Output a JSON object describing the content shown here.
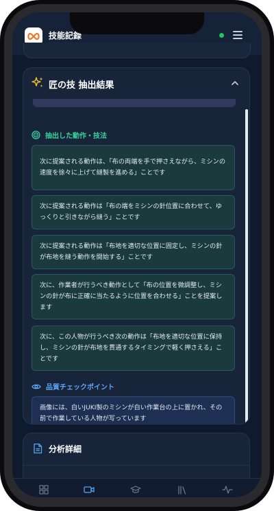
{
  "app": {
    "title": "技能記録",
    "logo_text": "",
    "status_color": "#22c55e"
  },
  "extraction": {
    "title": "匠の技 抽出結果",
    "icon": "sparkle-icon",
    "motions_label": "抽出した動作・技法",
    "motions": [
      "次に提案される動作は、「布の両端を手で押さえながら、ミシンの速度を徐々に上げて縫製を進める」ことです",
      "次に提案される動作は「布の端をミシンの針位置に合わせて、ゆっくりと引きながら縫う」ことです",
      "次に提案される動作は「布地を適切な位置に固定し、ミシンの針が布地を縫う動作を開始する」ことです",
      "次に、作業者が行うべき動作として「布の位置を微調整し、ミシンの針が布に正確に当たるように位置を合わせる」ことを提案します",
      "次に、この人物が行うべき次の動作は「布地を適切な位置に保持し、ミシンの針が布地を貫通するタイミングで軽く押さえる」ことです"
    ],
    "quality_label": "品質チェックポイント",
    "quality_items": [
      "画像には、白いJUKI製のミシンが白い作業台の上に置かれ、その前で作業している人物が写っています"
    ]
  },
  "analysis": {
    "title": "分析詳細"
  },
  "tabs": [
    "grid-icon",
    "video-icon",
    "graduation-cap-icon",
    "library-icon",
    "activity-icon"
  ],
  "colors": {
    "accent_green": "#36d39b",
    "accent_blue": "#5aa6f5",
    "active_tab": "#5aa6f5"
  }
}
